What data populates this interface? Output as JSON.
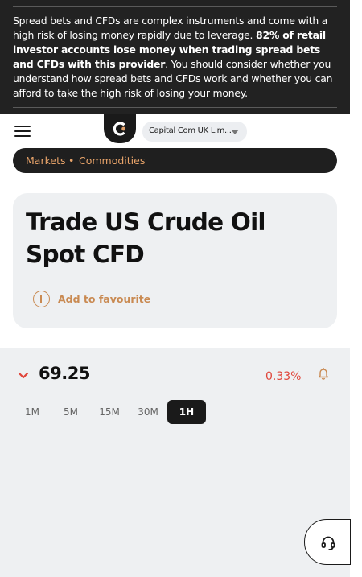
{
  "risk_warning": {
    "text_before": "Spread bets and CFDs are complex instruments and come with a high risk of losing money rapidly due to leverage. ",
    "text_bold": "82% of retail investor accounts lose money when trading spread bets and CFDs with this provider",
    "text_after": ". You should consider whether you understand how spread bets and CFDs work and whether you can afford to take the high risk of losing your money."
  },
  "header": {
    "menu_icon": "hamburger-menu-icon",
    "logo_icon": "capital-com-logo",
    "entity_selector": {
      "selected": "Capital Com UK Lim..."
    }
  },
  "breadcrumb": {
    "items": [
      "Markets",
      "Commodities"
    ],
    "separator": "•"
  },
  "instrument": {
    "title": "Trade US Crude Oil Spot CFD",
    "favourite_label": "Add to favourite"
  },
  "quote": {
    "direction_icon": "chevron-down-icon",
    "price": "69.25",
    "change": "0.33%",
    "alert_icon": "bell-icon"
  },
  "intervals": {
    "options": [
      "1M",
      "5M",
      "15M",
      "30M",
      "1H"
    ],
    "selected": "1H"
  },
  "support": {
    "icon": "headset-icon"
  },
  "colors": {
    "banner_bg": "#222222",
    "accent": "#c98a52",
    "breadcrumb_text": "#e9a46a",
    "negative": "#e0453a",
    "card_bg": "#eef0f2"
  }
}
